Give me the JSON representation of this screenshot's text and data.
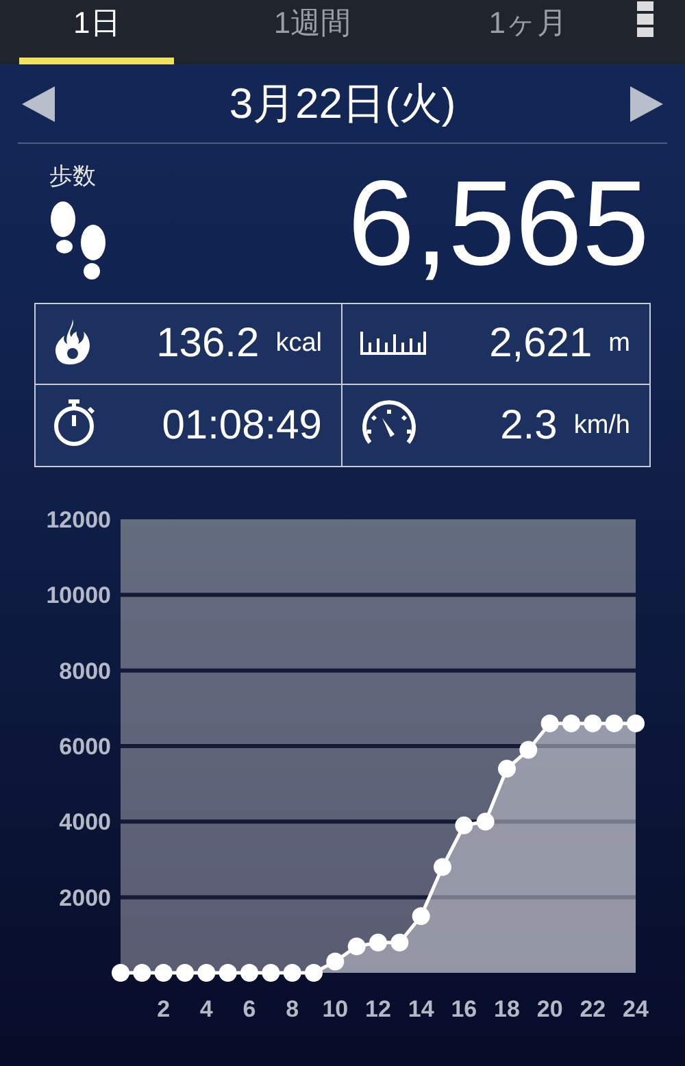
{
  "tabs": [
    {
      "label": "1日",
      "selected": true
    },
    {
      "label": "1週間",
      "selected": false
    },
    {
      "label": "1ヶ月",
      "selected": false
    }
  ],
  "date_nav": {
    "date": "3月22日(火)"
  },
  "steps": {
    "label": "歩数",
    "value": "6,565"
  },
  "stats": [
    {
      "kind": "calories",
      "value": "136.2",
      "unit": "kcal"
    },
    {
      "kind": "distance",
      "value": "2,621",
      "unit": "m"
    },
    {
      "kind": "duration",
      "value": "01:08:49"
    },
    {
      "kind": "speed",
      "value": "2.3",
      "unit": "km/h"
    }
  ],
  "chart": {
    "chart_data": {
      "type": "area",
      "x": [
        0,
        1,
        2,
        3,
        4,
        5,
        6,
        7,
        8,
        9,
        10,
        11,
        12,
        13,
        14,
        15,
        16,
        17,
        18,
        19,
        20,
        21,
        22,
        23,
        24
      ],
      "series": [
        {
          "color": "#ffffff",
          "values": [
            0,
            0,
            0,
            0,
            0,
            0,
            0,
            0,
            0,
            0,
            300,
            700,
            800,
            800,
            1500,
            2800,
            3900,
            4000,
            5400,
            5900,
            6600,
            6600,
            6600,
            6600,
            6600
          ]
        }
      ],
      "grid": true,
      "xlim": [
        0,
        24
      ],
      "ylim": [
        0,
        12000
      ],
      "xticks": [
        2,
        4,
        6,
        8,
        10,
        12,
        14,
        16,
        18,
        20,
        22,
        24
      ],
      "yticks": [
        2000,
        4000,
        6000,
        8000,
        10000,
        12000
      ]
    }
  }
}
